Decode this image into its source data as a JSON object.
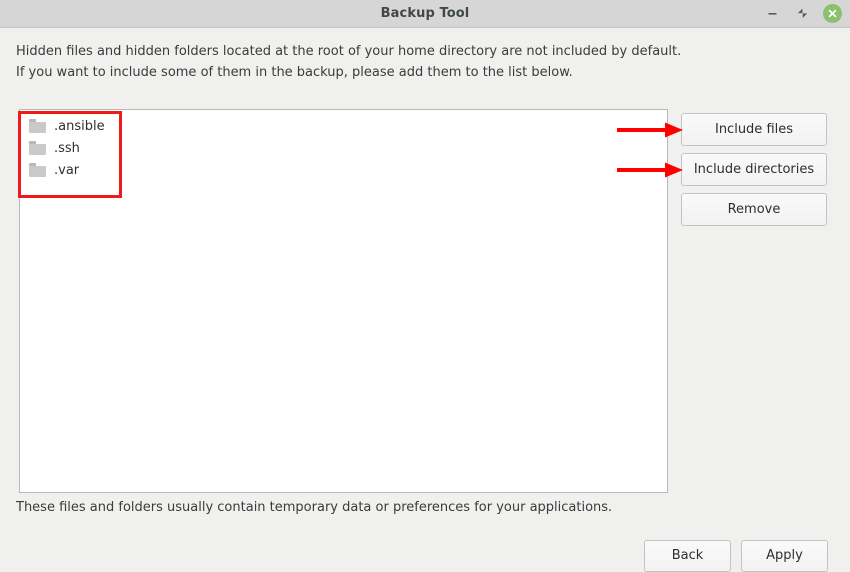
{
  "window": {
    "title": "Backup Tool",
    "controls": {
      "minimize_name": "minimize-button",
      "maximize_name": "maximize-button",
      "close_name": "close-button"
    },
    "accent_close_color": "#8cbf6e",
    "titlebar_color": "#d6d6d6",
    "background_color": "#f0f0ef"
  },
  "intro": {
    "line1": "Hidden files and hidden folders located at the root of your home directory are not included by default.",
    "line2": "If you want to include some of them in the backup, please add them to the list below."
  },
  "file_list": {
    "items": [
      {
        "name": ".ansible",
        "icon": "folder-icon"
      },
      {
        "name": ".ssh",
        "icon": "folder-icon"
      },
      {
        "name": ".var",
        "icon": "folder-icon"
      }
    ]
  },
  "side_buttons": {
    "include_files": "Include files",
    "include_directories": "Include directories",
    "remove": "Remove"
  },
  "annotations": {
    "highlight_color": "#ee1b1b",
    "arrow_color": "#ff0000",
    "arrow_targets": [
      "Include files",
      "Include directories"
    ]
  },
  "footer": {
    "note": "These files and folders usually contain temporary data or preferences for your applications.",
    "back": "Back",
    "apply": "Apply"
  }
}
